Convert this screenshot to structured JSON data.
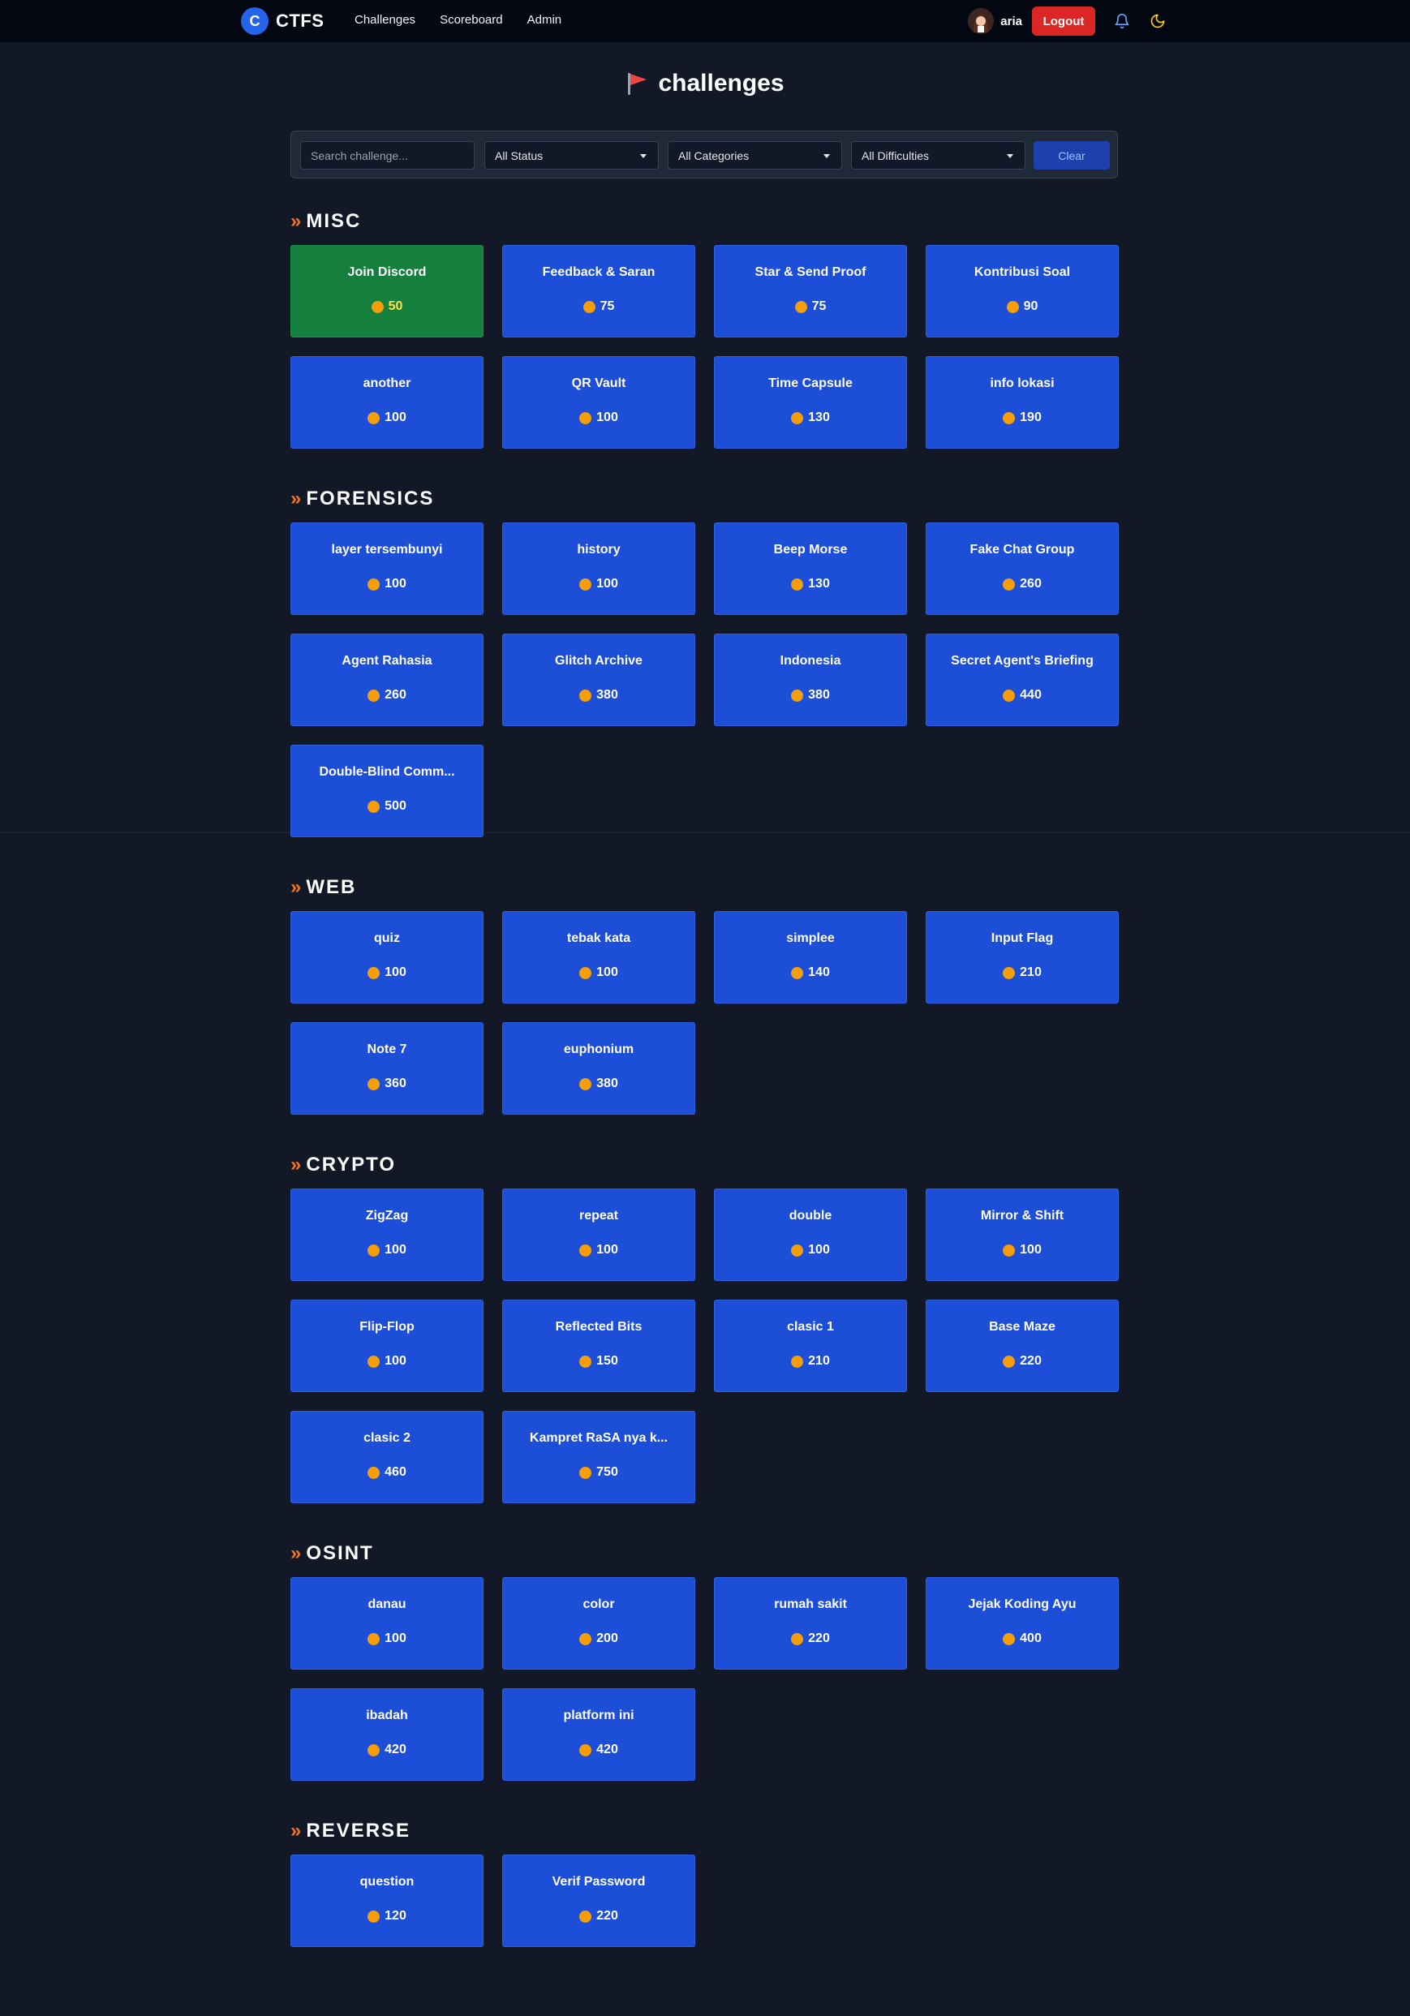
{
  "nav": {
    "brand_letter": "C",
    "brand_name": "CTFS",
    "links": [
      "Challenges",
      "Scoreboard",
      "Admin"
    ],
    "user": "aria",
    "logout_label": "Logout"
  },
  "page": {
    "title": "challenges"
  },
  "filters": {
    "search_placeholder": "Search challenge...",
    "status": "All Status",
    "categories": "All Categories",
    "difficulties": "All Difficulties",
    "clear_label": "Clear"
  },
  "colors": {
    "card": "#1d4ed8",
    "solved": "#15803d",
    "accent": "#f97316",
    "coin": "#f59e0b",
    "logout": "#dc2626"
  },
  "categories": [
    {
      "name": "MISC",
      "challenges": [
        {
          "name": "Join Discord",
          "points": 50,
          "solved": true
        },
        {
          "name": "Feedback & Saran",
          "points": 75
        },
        {
          "name": "Star & Send Proof",
          "points": 75
        },
        {
          "name": "Kontribusi Soal",
          "points": 90
        },
        {
          "name": "another",
          "points": 100
        },
        {
          "name": "QR Vault",
          "points": 100
        },
        {
          "name": "Time Capsule",
          "points": 130
        },
        {
          "name": "info lokasi",
          "points": 190
        }
      ]
    },
    {
      "name": "FORENSICS",
      "challenges": [
        {
          "name": "layer tersembunyi",
          "points": 100
        },
        {
          "name": "history",
          "points": 100
        },
        {
          "name": "Beep Morse",
          "points": 130
        },
        {
          "name": "Fake Chat Group",
          "points": 260
        },
        {
          "name": "Agent Rahasia",
          "points": 260
        },
        {
          "name": "Glitch Archive",
          "points": 380
        },
        {
          "name": "Indonesia",
          "points": 380
        },
        {
          "name": "Secret Agent's Briefing",
          "points": 440
        },
        {
          "name": "Double-Blind Comm...",
          "points": 500
        }
      ]
    },
    {
      "name": "WEB",
      "challenges": [
        {
          "name": "quiz",
          "points": 100
        },
        {
          "name": "tebak kata",
          "points": 100
        },
        {
          "name": "simplee",
          "points": 140
        },
        {
          "name": "Input Flag",
          "points": 210
        },
        {
          "name": "Note 7",
          "points": 360
        },
        {
          "name": "euphonium",
          "points": 380
        }
      ]
    },
    {
      "name": "CRYPTO",
      "challenges": [
        {
          "name": "ZigZag",
          "points": 100
        },
        {
          "name": "repeat",
          "points": 100
        },
        {
          "name": "double",
          "points": 100
        },
        {
          "name": "Mirror & Shift",
          "points": 100
        },
        {
          "name": "Flip-Flop",
          "points": 100
        },
        {
          "name": "Reflected Bits",
          "points": 150
        },
        {
          "name": "clasic 1",
          "points": 210
        },
        {
          "name": "Base Maze",
          "points": 220
        },
        {
          "name": "clasic 2",
          "points": 460
        },
        {
          "name": "Kampret RaSA nya k...",
          "points": 750
        }
      ]
    },
    {
      "name": "OSINT",
      "challenges": [
        {
          "name": "danau",
          "points": 100
        },
        {
          "name": "color",
          "points": 200
        },
        {
          "name": "rumah sakit",
          "points": 220
        },
        {
          "name": "Jejak Koding Ayu",
          "points": 400
        },
        {
          "name": "ibadah",
          "points": 420
        },
        {
          "name": "platform ini",
          "points": 420
        }
      ]
    },
    {
      "name": "REVERSE",
      "challenges": [
        {
          "name": "question",
          "points": 120
        },
        {
          "name": "Verif Password",
          "points": 220
        }
      ]
    }
  ]
}
